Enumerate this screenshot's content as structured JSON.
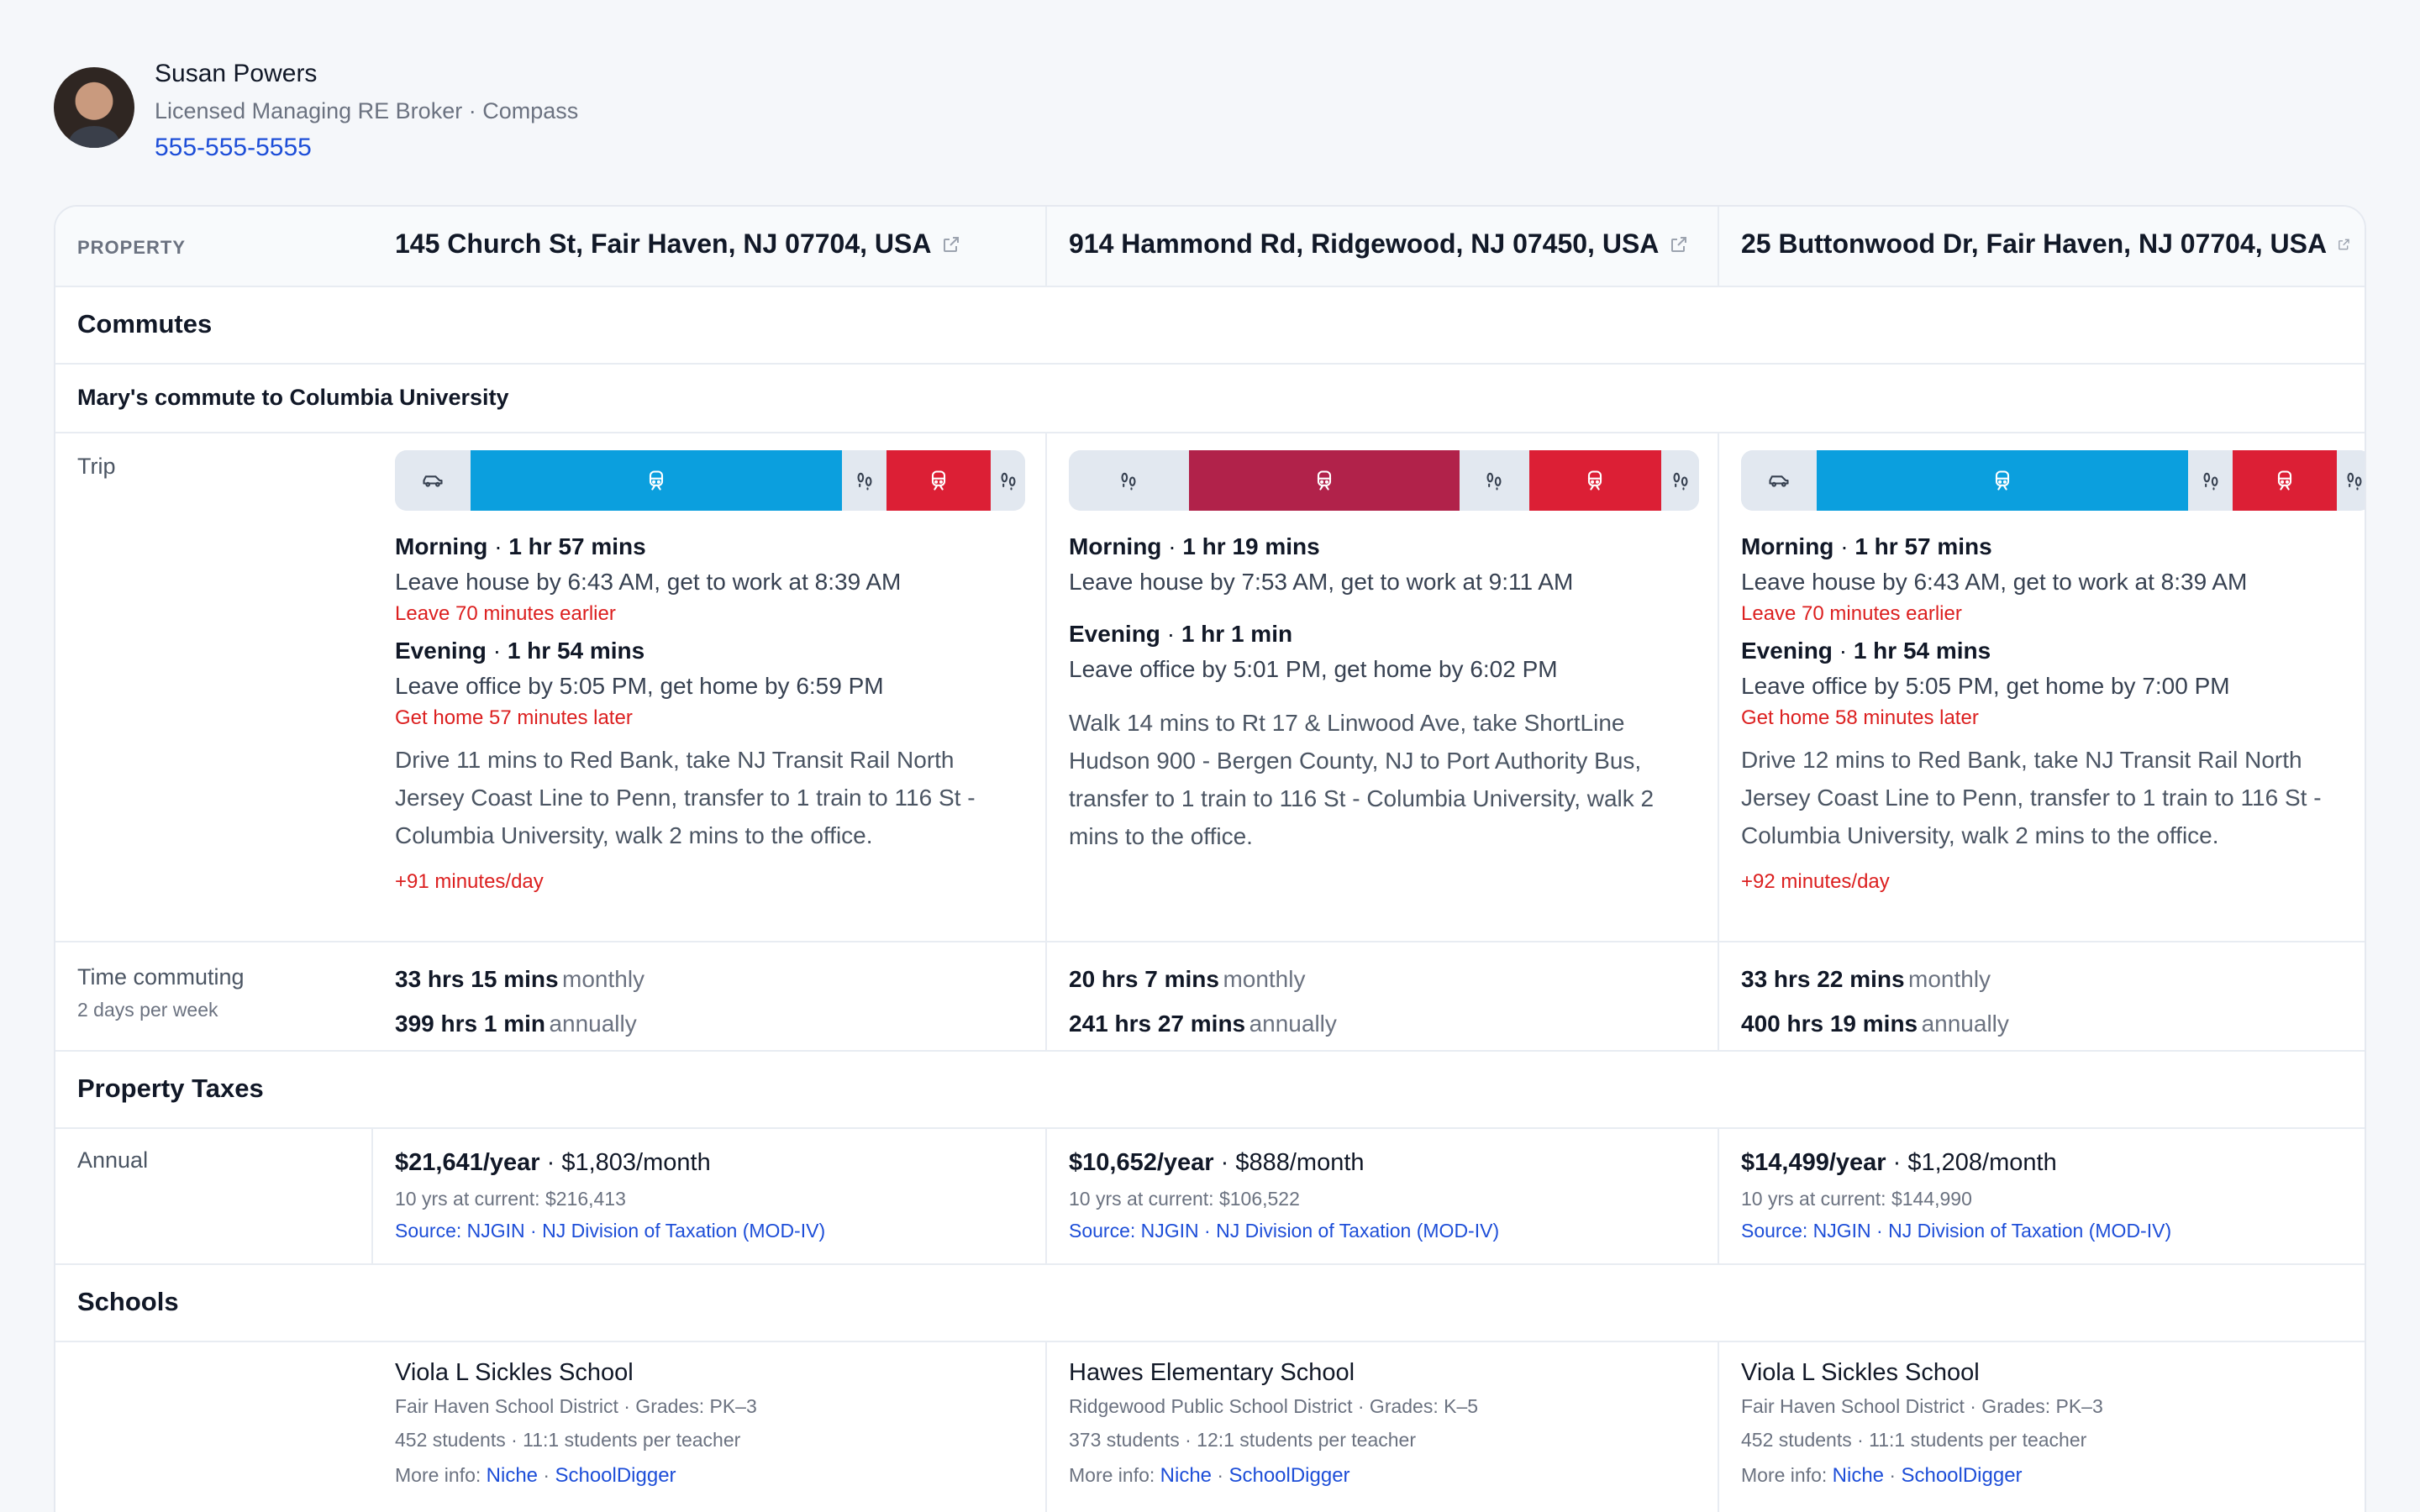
{
  "agent": {
    "name": "Susan Powers",
    "title": "Licensed Managing RE Broker · Compass",
    "phone": "555-555-5555"
  },
  "labels": {
    "property": "PROPERTY",
    "commutes": "Commutes",
    "commute_title": "Mary's commute to Columbia University",
    "trip": "Trip",
    "time_commuting": "Time commuting",
    "time_commuting_sub": "2 days per week",
    "property_taxes": "Property Taxes",
    "annual": "Annual",
    "schools": "Schools",
    "monthly": "monthly",
    "annually": "annually",
    "more_info": "More info:",
    "niche": "Niche",
    "schooldigger": "SchoolDigger",
    "source_prefix": "Source:",
    "source_njgin": "NJGIN",
    "source_tax": "NJ Division of Taxation (MOD-IV)",
    "dot": "·"
  },
  "colors": {
    "transit_blue": "#0b9fde",
    "transit_red": "#dc1f35",
    "bus_maroon": "#b1224a",
    "segment_gray": "#e2e8f0",
    "link_blue": "#1d4ed8",
    "alert_red": "#dc1f1f"
  },
  "properties": [
    {
      "address": "145 Church St, Fair Haven, NJ 07704, USA",
      "trip_segments": [
        {
          "mode": "car-icon",
          "color": "gray",
          "share": 0.12
        },
        {
          "mode": "train-icon",
          "color": "blue",
          "share": 0.59
        },
        {
          "mode": "walk-icon",
          "color": "gray",
          "share": 0.07
        },
        {
          "mode": "train-icon",
          "color": "red",
          "share": 0.165
        },
        {
          "mode": "walk-icon",
          "color": "gray",
          "share": 0.055
        }
      ],
      "morning_label": "Morning",
      "morning_duration": "1 hr 57 mins",
      "morning_detail": "Leave house by 6:43 AM, get to work at 8:39 AM",
      "morning_alert": "Leave 70 minutes earlier",
      "evening_label": "Evening",
      "evening_duration": "1 hr 54 mins",
      "evening_detail": "Leave office by 5:05 PM, get home by 6:59 PM",
      "evening_alert": "Get home 57 minutes later",
      "route": "Drive 11 mins to Red Bank, take NJ Transit Rail North Jersey Coast Line to Penn, transfer to 1 train to 116 St - Columbia University, walk 2 mins to the office.",
      "per_day": "+91 minutes/day",
      "monthly": "33 hrs 15 mins",
      "annually": "399 hrs 1 min",
      "tax_year": "$21,641/year",
      "tax_month": "$1,803/month",
      "tax_10yr": "10 yrs at current: $216,413",
      "school_name": "Viola L Sickles School",
      "school_district": "Fair Haven School District · Grades: PK–3",
      "school_students": "452 students · 11:1 students per teacher"
    },
    {
      "address": "914 Hammond Rd, Ridgewood, NJ 07450, USA",
      "trip_segments": [
        {
          "mode": "walk-icon",
          "color": "gray",
          "share": 0.19
        },
        {
          "mode": "bus-icon",
          "color": "maroon",
          "share": 0.43
        },
        {
          "mode": "walk-icon",
          "color": "gray",
          "share": 0.11
        },
        {
          "mode": "train-icon",
          "color": "red",
          "share": 0.21
        },
        {
          "mode": "walk-icon",
          "color": "gray",
          "share": 0.06
        }
      ],
      "morning_label": "Morning",
      "morning_duration": "1 hr 19 mins",
      "morning_detail": "Leave house by 7:53 AM, get to work at 9:11 AM",
      "morning_alert": "",
      "evening_label": "Evening",
      "evening_duration": "1 hr 1 min",
      "evening_detail": "Leave office by 5:01 PM, get home by 6:02 PM",
      "evening_alert": "",
      "route": "Walk 14 mins to Rt 17 & Linwood Ave, take ShortLine Hudson 900 - Bergen County, NJ to Port Authority Bus, transfer to 1 train to 116 St - Columbia University, walk 2 mins to the office.",
      "per_day": "",
      "monthly": "20 hrs 7 mins",
      "annually": "241 hrs 27 mins",
      "tax_year": "$10,652/year",
      "tax_month": "$888/month",
      "tax_10yr": "10 yrs at current: $106,522",
      "school_name": "Hawes Elementary School",
      "school_district": "Ridgewood Public School District · Grades: K–5",
      "school_students": "373 students · 12:1 students per teacher"
    },
    {
      "address": "25 Buttonwood Dr, Fair Haven, NJ 07704, USA",
      "trip_segments": [
        {
          "mode": "car-icon",
          "color": "gray",
          "share": 0.12
        },
        {
          "mode": "train-icon",
          "color": "blue",
          "share": 0.59
        },
        {
          "mode": "walk-icon",
          "color": "gray",
          "share": 0.07
        },
        {
          "mode": "train-icon",
          "color": "red",
          "share": 0.165
        },
        {
          "mode": "walk-icon",
          "color": "gray",
          "share": 0.055
        }
      ],
      "morning_label": "Morning",
      "morning_duration": "1 hr 57 mins",
      "morning_detail": "Leave house by 6:43 AM, get to work at 8:39 AM",
      "morning_alert": "Leave 70 minutes earlier",
      "evening_label": "Evening",
      "evening_duration": "1 hr 54 mins",
      "evening_detail": "Leave office by 5:05 PM, get home by 7:00 PM",
      "evening_alert": "Get home 58 minutes later",
      "route": "Drive 12 mins to Red Bank, take NJ Transit Rail North Jersey Coast Line to Penn, transfer to 1 train to 116 St - Columbia University, walk 2 mins to the office.",
      "per_day": "+92 minutes/day",
      "monthly": "33 hrs 22 mins",
      "annually": "400 hrs 19 mins",
      "tax_year": "$14,499/year",
      "tax_month": "$1,208/month",
      "tax_10yr": "10 yrs at current: $144,990",
      "school_name": "Viola L Sickles School",
      "school_district": "Fair Haven School District · Grades: PK–3",
      "school_students": "452 students · 11:1 students per teacher"
    }
  ]
}
